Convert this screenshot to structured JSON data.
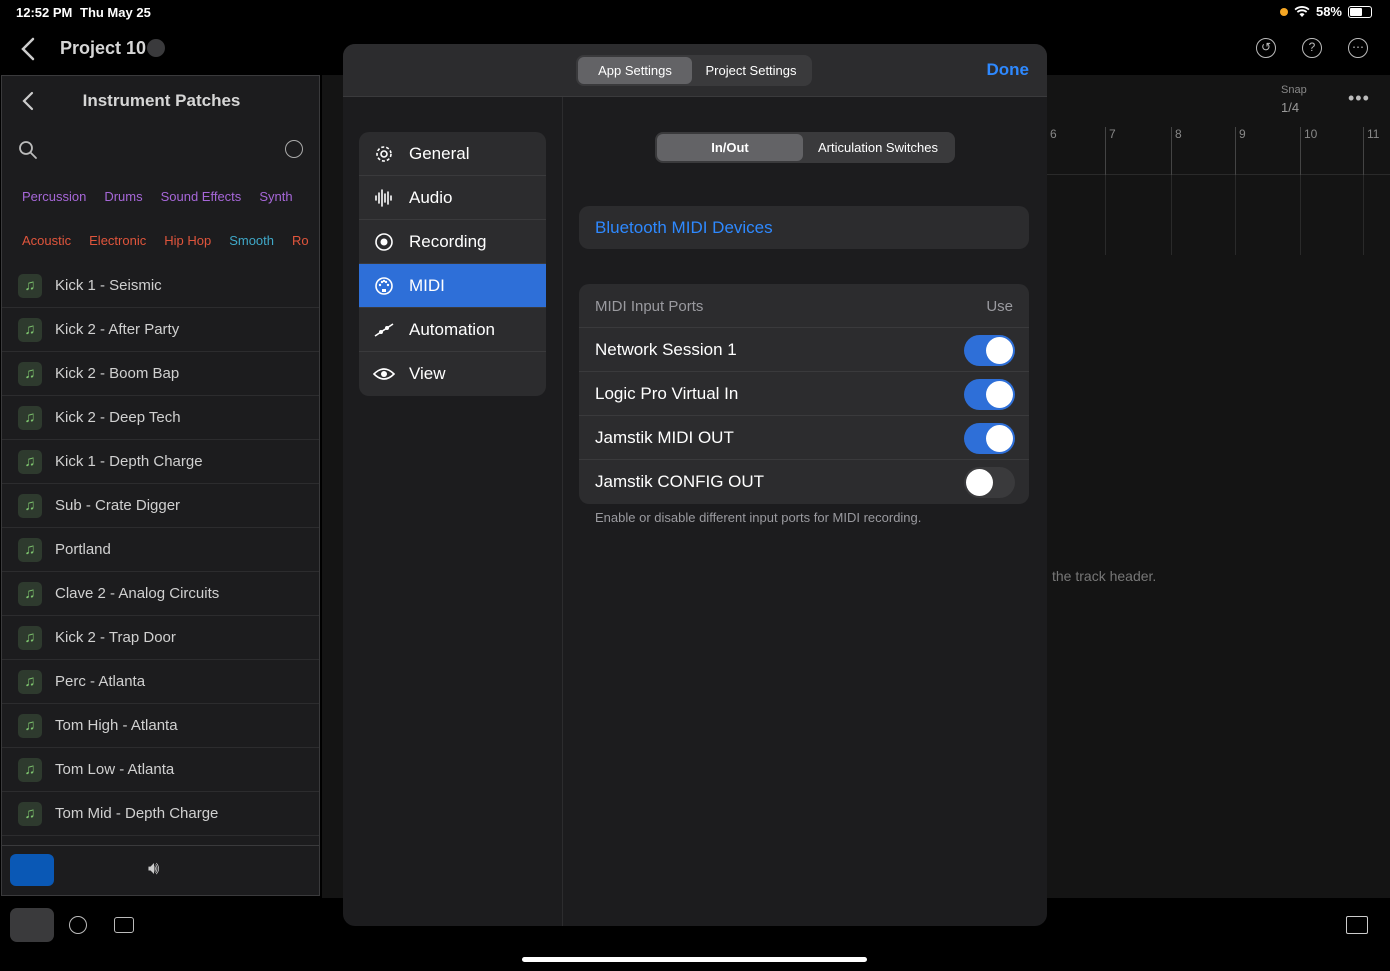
{
  "status": {
    "time": "12:52 PM",
    "date": "Thu May 25",
    "battery": "58%",
    "battery_level": 0.58
  },
  "topnav": {
    "project_title": "Project 10"
  },
  "library": {
    "title": "Instrument Patches",
    "tags_row1": [
      "Percussion",
      "Drums",
      "Sound Effects",
      "Synth"
    ],
    "tags_row2": [
      "Acoustic",
      "Electronic",
      "Hip Hop",
      "Smooth",
      "Ro"
    ],
    "patches": [
      "Kick 1 - Seismic",
      "Kick 2 - After Party",
      "Kick 2 - Boom Bap",
      "Kick 2 - Deep Tech",
      "Kick 1 - Depth Charge",
      "Sub - Crate Digger",
      "Portland",
      "Clave 2 - Analog Circuits",
      "Kick 2 - Trap Door",
      "Perc - Atlanta",
      "Tom High - Atlanta",
      "Tom Low - Atlanta",
      "Tom Mid - Depth Charge"
    ]
  },
  "tracks": {
    "snap_label": "Snap",
    "snap_value": "1/4",
    "ruler": [
      "6",
      "7",
      "8",
      "9",
      "10",
      "11"
    ],
    "hint": "the track header."
  },
  "modal": {
    "tabs": [
      "App Settings",
      "Project Settings"
    ],
    "done_label": "Done",
    "menu": [
      {
        "label": "General",
        "icon": "gear-icon"
      },
      {
        "label": "Audio",
        "icon": "waveform-icon"
      },
      {
        "label": "Recording",
        "icon": "record-icon"
      },
      {
        "label": "MIDI",
        "icon": "midi-icon"
      },
      {
        "label": "Automation",
        "icon": "automation-icon"
      },
      {
        "label": "View",
        "icon": "eye-icon"
      }
    ],
    "subtabs": [
      "In/Out",
      "Articulation Switches"
    ],
    "bluetooth_label": "Bluetooth MIDI Devices",
    "ports_header": "MIDI Input Ports",
    "ports_use": "Use",
    "ports": [
      {
        "name": "Network Session 1",
        "enabled": true
      },
      {
        "name": "Logic Pro Virtual In",
        "enabled": true
      },
      {
        "name": "Jamstik MIDI OUT",
        "enabled": true
      },
      {
        "name": "Jamstik CONFIG OUT",
        "enabled": false
      }
    ],
    "ports_footer": "Enable or disable different input ports for MIDI recording."
  }
}
